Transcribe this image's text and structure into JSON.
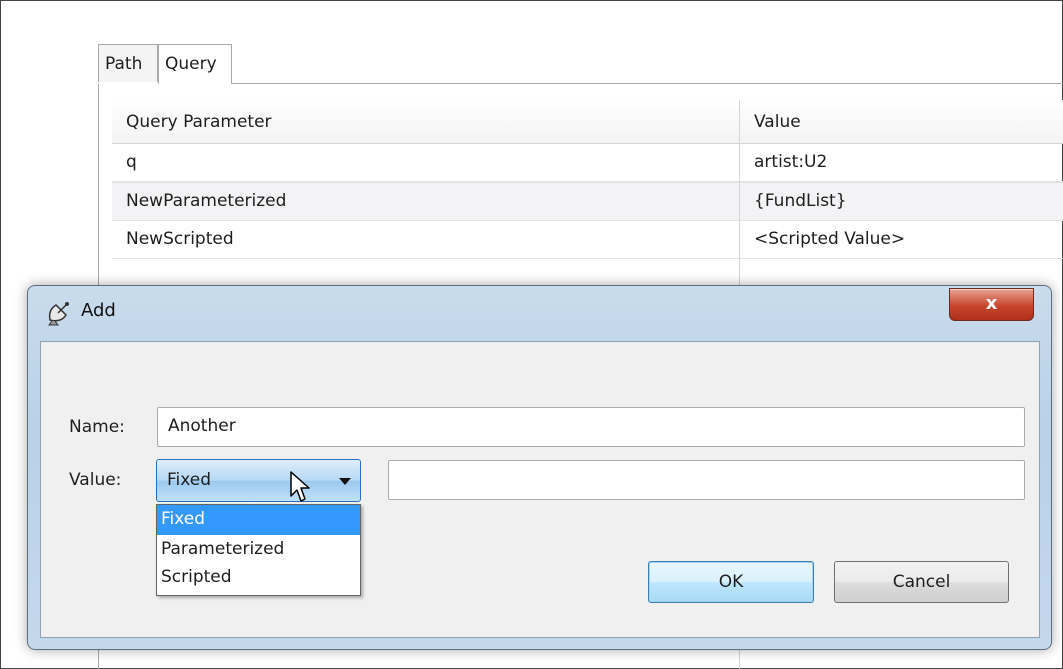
{
  "tabs": [
    {
      "label": "Path"
    },
    {
      "label": "Query"
    }
  ],
  "table": {
    "headers": [
      "Query Parameter",
      "Value"
    ],
    "rows": [
      {
        "param": "q",
        "value": "artist:U2"
      },
      {
        "param": "NewParameterized",
        "value": "{FundList}"
      },
      {
        "param": "NewScripted",
        "value": "<Scripted Value>"
      }
    ]
  },
  "dialog": {
    "title": "Add",
    "close_label": "x",
    "name_label": "Name:",
    "name_value": "Another",
    "value_label": "Value:",
    "value_selected": "Fixed",
    "value_text": "",
    "options": [
      "Fixed",
      "Parameterized",
      "Scripted"
    ],
    "ok_label": "OK",
    "cancel_label": "Cancel"
  },
  "icons": {
    "dialog_icon": "satellite-dish-icon",
    "combo_arrow": "chevron-down-icon",
    "cursor": "mouse-pointer-icon"
  },
  "colors": {
    "selection": "#3399ff",
    "close_button": "#c7452c",
    "dialog_frame": "#b9d0e6"
  }
}
